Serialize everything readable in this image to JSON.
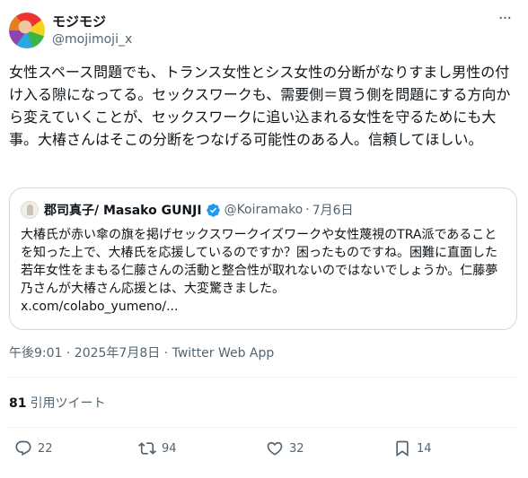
{
  "author": {
    "display_name": "モジモジ",
    "handle": "@mojimoji_x",
    "avatar": "colorful-avatar"
  },
  "more_icon": "more-dots-icon",
  "post_text": "女性スペース問題でも、トランス女性とシス女性の分断がなりすまし男性の付け入る隙になってる。セックスワークも、需要側＝買う側を問題にする方向から変えていくことが、セックスワークに追い込まれる女性を守るためにも大事。大椿さんはそこの分断をつなげる可能性のある人。信頼してほしい。",
  "quoted_post": {
    "display_name": "郡司真子/ Masako GUNJI",
    "verified_icon": "verified-badge-icon",
    "handle": "@Koiramako",
    "separator": "·",
    "date": "7月6日",
    "text": "大椿氏が赤い傘の旗を掲げセックスワークイズワークや女性蔑視のTRA派であることを知った上で、大椿氏を応援しているのですか？困ったものですね。困難に直面した若年女性をまもる仁藤さんの活動と整合性が取れないのではないでしょうか。仁藤夢乃さんが大椿さん応援とは、大変驚きました。",
    "link": "x.com/colabo_yumeno/..."
  },
  "meta": "午後9:01 · 2025年7月8日 · Twitter Web App",
  "stats": {
    "quotes_count": "81",
    "quotes_label": "引用ツイート"
  },
  "actions": {
    "reply_count": "22",
    "retweet_count": "94",
    "like_count": "32",
    "bookmark_count": "14"
  },
  "colors": {
    "text": "#0f1419",
    "secondary": "#536471",
    "border": "#cfd9de",
    "verified": "#1d9bf0"
  }
}
